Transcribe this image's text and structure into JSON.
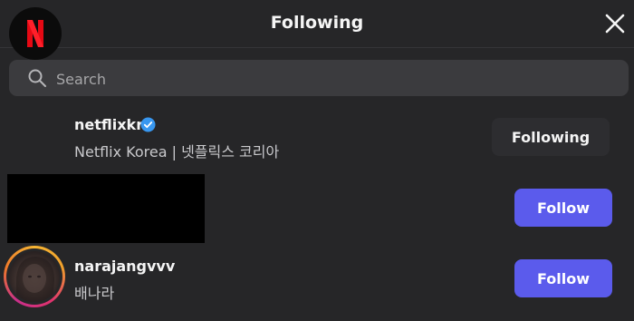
{
  "header": {
    "title": "Following",
    "close_icon": "close-icon"
  },
  "search": {
    "placeholder": "Search",
    "value": "",
    "icon": "search-icon"
  },
  "accounts": [
    {
      "username": "netflixkr",
      "display_name": "Netflix Korea | 넷플릭스 코리아",
      "verified": true,
      "button_label": "Following",
      "avatar": "netflix-logo"
    },
    {
      "redacted": true,
      "button_label": "Follow"
    },
    {
      "username": "narajangvvv",
      "display_name": "배나라",
      "story_ring": true,
      "button_label": "Follow",
      "avatar": "profile-photo"
    }
  ],
  "colors": {
    "background": "#262628",
    "follow_button": "#5b5bec",
    "following_button": "#2d2d30",
    "verified_badge": "#3897f0",
    "netflix_red": "#e50914"
  }
}
